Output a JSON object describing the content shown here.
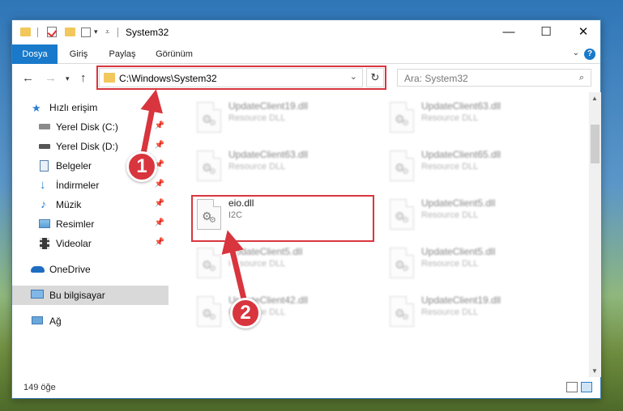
{
  "window": {
    "title": "System32"
  },
  "ribbon": {
    "tabs": [
      "Dosya",
      "Giriş",
      "Paylaş",
      "Görünüm"
    ],
    "help": "?"
  },
  "controls": {
    "minimize": "—",
    "maximize": "☐",
    "close": "✕"
  },
  "address": {
    "path": "C:\\Windows\\System32"
  },
  "search": {
    "placeholder": "Ara: System32"
  },
  "sidebar": {
    "items": [
      {
        "label": "Hızlı erişim",
        "icon": "star-icon"
      },
      {
        "label": "Yerel Disk (C:)",
        "icon": "drive-icon",
        "pinned": true
      },
      {
        "label": "Yerel Disk (D:)",
        "icon": "drive-icon",
        "pinned": true
      },
      {
        "label": "Belgeler",
        "icon": "documents-icon",
        "pinned": true
      },
      {
        "label": "İndirmeler",
        "icon": "download-icon",
        "pinned": true
      },
      {
        "label": "Müzik",
        "icon": "music-icon",
        "pinned": true
      },
      {
        "label": "Resimler",
        "icon": "pictures-icon",
        "pinned": true
      },
      {
        "label": "Videolar",
        "icon": "videos-icon",
        "pinned": true
      },
      {
        "label": "OneDrive",
        "icon": "cloud-icon"
      },
      {
        "label": "Bu bilgisayar",
        "icon": "computer-icon",
        "selected": true
      },
      {
        "label": "Ağ",
        "icon": "network-icon"
      }
    ]
  },
  "files": {
    "left": [
      {
        "name": "UpdateClient19.dll",
        "type": "Resource DLL"
      },
      {
        "name": "UpdateClient63.dll",
        "type": "Resource DLL"
      },
      {
        "name": "eio.dll",
        "type": "I2C"
      },
      {
        "name": "UpdateClient5.dll",
        "type": "Resource DLL"
      },
      {
        "name": "UpdateClient42.dll",
        "type": "Resource DLL"
      }
    ],
    "right": [
      {
        "name": "UpdateClient63.dll",
        "type": "Resource DLL"
      },
      {
        "name": "UpdateClient65.dll",
        "type": "Resource DLL"
      },
      {
        "name": "UpdateClient5.dll",
        "type": "Resource DLL"
      },
      {
        "name": "UpdateClient5.dll",
        "type": "Resource DLL"
      },
      {
        "name": "UpdateClient19.dll",
        "type": "Resource DLL"
      }
    ]
  },
  "status": {
    "count": "149 öğe"
  },
  "callouts": {
    "one": "1",
    "two": "2"
  },
  "colors": {
    "accent": "#1979ca",
    "highlight": "#d9363e"
  }
}
